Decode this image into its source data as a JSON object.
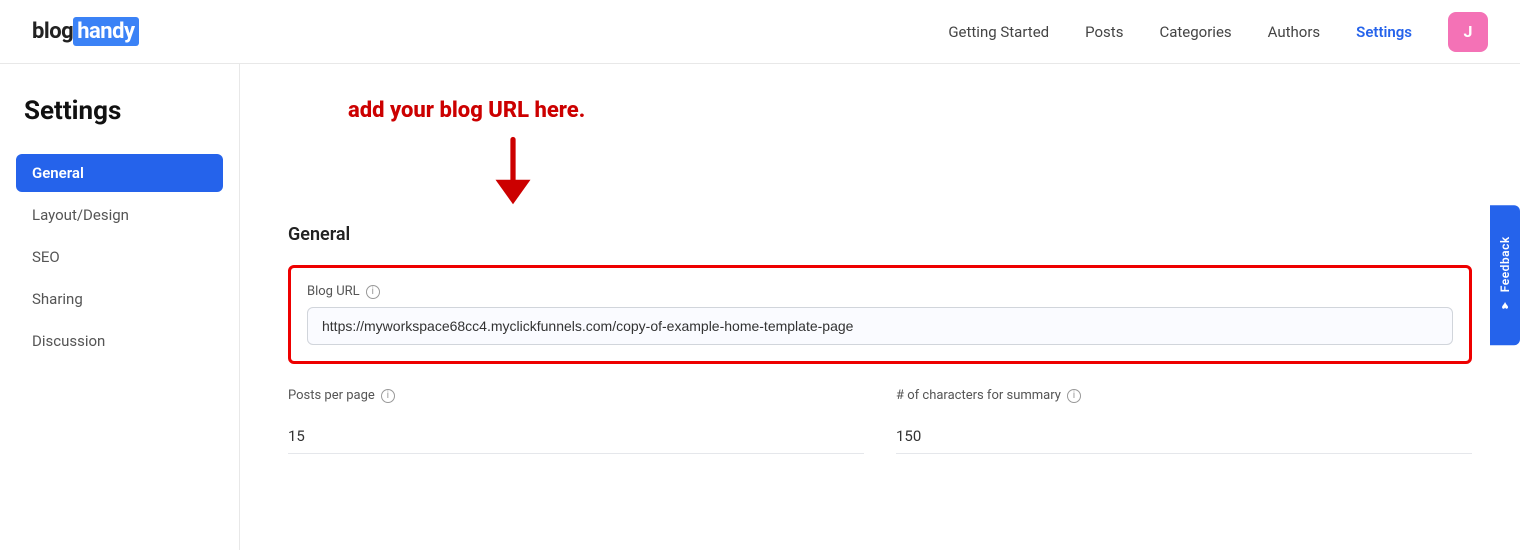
{
  "logo": {
    "prefix": "blog",
    "highlight": "handy"
  },
  "nav": {
    "links": [
      {
        "label": "Getting Started",
        "active": false
      },
      {
        "label": "Posts",
        "active": false
      },
      {
        "label": "Categories",
        "active": false
      },
      {
        "label": "Authors",
        "active": false
      },
      {
        "label": "Settings",
        "active": true
      }
    ],
    "avatar_letter": "J"
  },
  "sidebar": {
    "title": "Settings",
    "items": [
      {
        "label": "General",
        "active": true
      },
      {
        "label": "Layout/Design",
        "active": false
      },
      {
        "label": "SEO",
        "active": false
      },
      {
        "label": "Sharing",
        "active": false
      },
      {
        "label": "Discussion",
        "active": false
      }
    ]
  },
  "annotation": {
    "text": "add your blog URL here.",
    "arrow": true
  },
  "content": {
    "section_title": "General",
    "blog_url": {
      "label": "Blog URL",
      "value": "https://myworkspace68cc4.myclickfunnels.com/copy-of-example-home-template-page",
      "placeholder": "https://myworkspace68cc4.myclickfunnels.com/copy-of-example-home-template-page"
    },
    "posts_per_page": {
      "label": "Posts per page",
      "value": "15"
    },
    "characters_for_summary": {
      "label": "# of characters for summary",
      "value": "150"
    }
  },
  "feedback": {
    "label": "Feedback",
    "heart": "♥"
  }
}
